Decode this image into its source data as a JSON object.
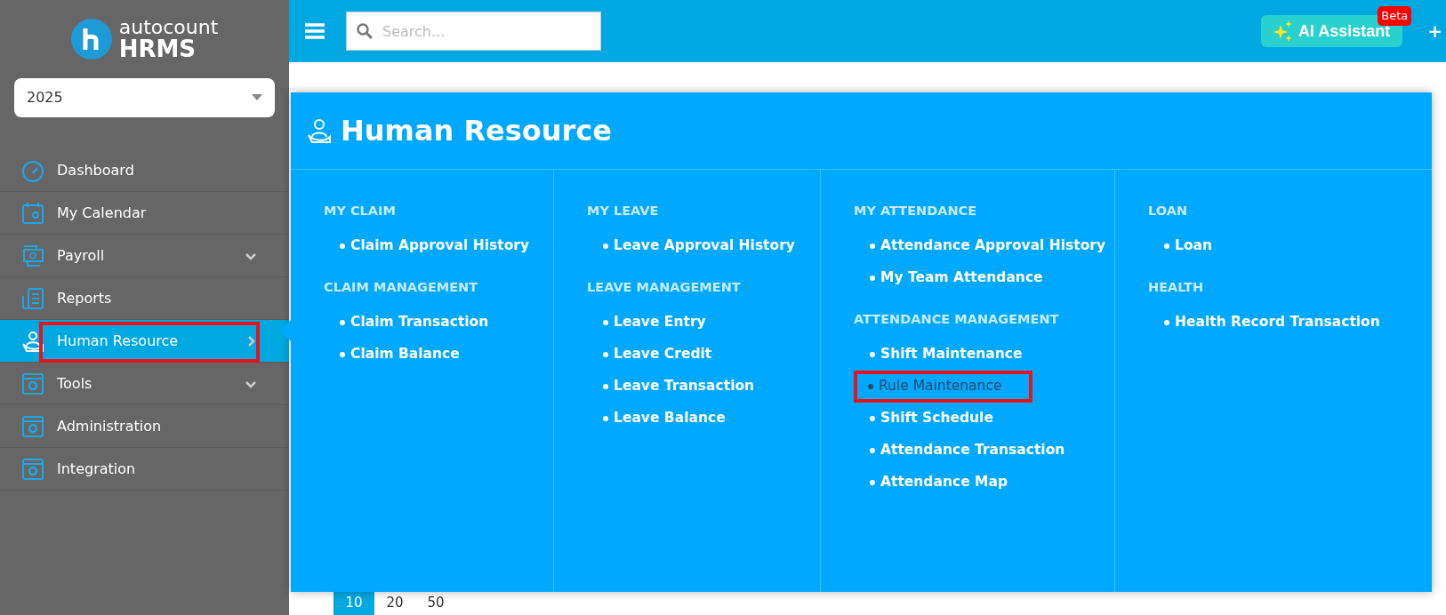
{
  "brand": {
    "small": "autocount",
    "big": "HRMS"
  },
  "year_select": {
    "value": "2025"
  },
  "sidebar": {
    "items": [
      {
        "label": "Dashboard",
        "selected": false,
        "highlighted": false,
        "kind": "plain"
      },
      {
        "label": "My Calendar",
        "selected": false,
        "highlighted": false,
        "kind": "plain"
      },
      {
        "label": "Payroll",
        "selected": false,
        "highlighted": false,
        "kind": "collapsible"
      },
      {
        "label": "Reports",
        "selected": false,
        "highlighted": false,
        "kind": "plain"
      },
      {
        "label": "Human Resource",
        "selected": true,
        "highlighted": true,
        "kind": "flyout"
      },
      {
        "label": "Tools",
        "selected": false,
        "highlighted": false,
        "kind": "collapsible"
      },
      {
        "label": "Administration",
        "selected": false,
        "highlighted": false,
        "kind": "plain"
      },
      {
        "label": "Integration",
        "selected": false,
        "highlighted": false,
        "kind": "plain"
      }
    ]
  },
  "topbar": {
    "search": {
      "placeholder": "Search..."
    },
    "ai_button": "AI Assistant",
    "ai_badge": "Beta",
    "plus": "+"
  },
  "mega_menu": {
    "title": "Human Resource",
    "columns": [
      {
        "groups": [
          {
            "heading": "MY CLAIM",
            "links": [
              {
                "label": "Claim Approval History",
                "highlighted": false
              }
            ]
          },
          {
            "heading": "CLAIM MANAGEMENT",
            "links": [
              {
                "label": "Claim Transaction",
                "highlighted": false
              },
              {
                "label": "Claim Balance",
                "highlighted": false
              }
            ]
          }
        ]
      },
      {
        "groups": [
          {
            "heading": "MY LEAVE",
            "links": [
              {
                "label": "Leave Approval History",
                "highlighted": false
              }
            ]
          },
          {
            "heading": "LEAVE MANAGEMENT",
            "links": [
              {
                "label": "Leave Entry",
                "highlighted": false
              },
              {
                "label": "Leave Credit",
                "highlighted": false
              },
              {
                "label": "Leave Transaction",
                "highlighted": false
              },
              {
                "label": "Leave Balance",
                "highlighted": false
              }
            ]
          }
        ]
      },
      {
        "groups": [
          {
            "heading": "MY ATTENDANCE",
            "links": [
              {
                "label": "Attendance Approval History",
                "highlighted": false
              },
              {
                "label": "My Team Attendance",
                "highlighted": false
              }
            ]
          },
          {
            "heading": "ATTENDANCE MANAGEMENT",
            "links": [
              {
                "label": "Shift Maintenance",
                "highlighted": false
              },
              {
                "label": "Rule Maintenance",
                "highlighted": true
              },
              {
                "label": "Shift Schedule",
                "highlighted": false
              },
              {
                "label": "Attendance Transaction",
                "highlighted": false
              },
              {
                "label": "Attendance Map",
                "highlighted": false
              }
            ]
          }
        ]
      },
      {
        "groups": [
          {
            "heading": "LOAN",
            "links": [
              {
                "label": "Loan",
                "highlighted": false
              }
            ]
          },
          {
            "heading": "HEALTH",
            "links": [
              {
                "label": "Health Record Transaction",
                "highlighted": false
              }
            ]
          }
        ]
      }
    ]
  },
  "pagination": [
    {
      "label": "10",
      "selected": true
    },
    {
      "label": "20",
      "selected": false
    },
    {
      "label": "50",
      "selected": false
    }
  ]
}
